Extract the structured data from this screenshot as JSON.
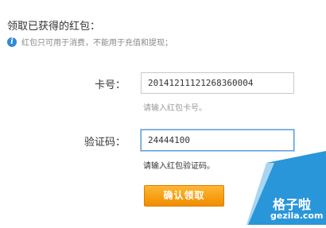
{
  "header": {
    "title": "领取已获得的红包：",
    "notice": "红包只可用于消费，不能用于充值和提现；",
    "notice_icon": "info-icon"
  },
  "form": {
    "card": {
      "label": "卡号：",
      "value": "20141211121268360004",
      "hint": "请输入红包卡号。"
    },
    "code": {
      "label": "验证码：",
      "value": "24444100",
      "hint": "请输入红包验证码。"
    },
    "submit_label": "确认领取"
  },
  "watermark": {
    "text": "格子啦",
    "site": "gezila.com"
  },
  "colors": {
    "accent_orange": "#f39800",
    "info_blue": "#2f8ad6",
    "watermark_blue": "#1e90d8"
  }
}
